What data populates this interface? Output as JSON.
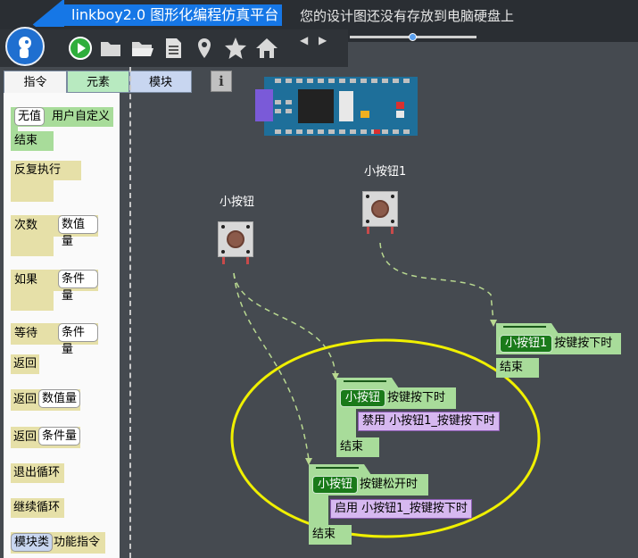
{
  "title": "linkboy2.0 图形化编程仿真平台",
  "save_hint": "您的设计图还没有存放到电脑硬盘上",
  "toolbar": {
    "nav_arrows": "◀ ▶",
    "zoom_level": 0.5
  },
  "tabs": [
    "指令",
    "元素",
    "模块"
  ],
  "info_button": "i",
  "palette": {
    "user_def": {
      "inner": "无值",
      "label": "用户自定义",
      "end": "结束"
    },
    "repeat": "反复执行",
    "times": {
      "label": "次数",
      "inner": "数值量"
    },
    "if": {
      "label": "如果",
      "inner": "条件量"
    },
    "wait": {
      "label": "等待",
      "inner": "条件量"
    },
    "return": "返回",
    "return_num": {
      "label": "返回",
      "inner": "数值量"
    },
    "return_cond": {
      "label": "返回",
      "inner": "条件量"
    },
    "exit_loop": "退出循环",
    "continue_loop": "继续循环",
    "module_func": {
      "inner": "模块类",
      "label": "功能指令"
    }
  },
  "components": {
    "button1": "小按钮1",
    "button": "小按钮"
  },
  "events": {
    "e1": {
      "name": "小按钮1",
      "event": "按键按下时",
      "end": "结束"
    },
    "e2": {
      "name": "小按钮",
      "event": "按键按下时",
      "cmd_verb": "禁用",
      "cmd_target": "小按钮1_按键按下时",
      "end": "结束"
    },
    "e3": {
      "name": "小按钮",
      "event": "按键松开时",
      "cmd_verb": "启用",
      "cmd_target": "小按钮1_按键按下时",
      "end": "结束"
    }
  },
  "colors": {
    "title_tab": "#1677e6",
    "highlight_ellipse": "#f0f000",
    "connector": "#b8d890"
  }
}
